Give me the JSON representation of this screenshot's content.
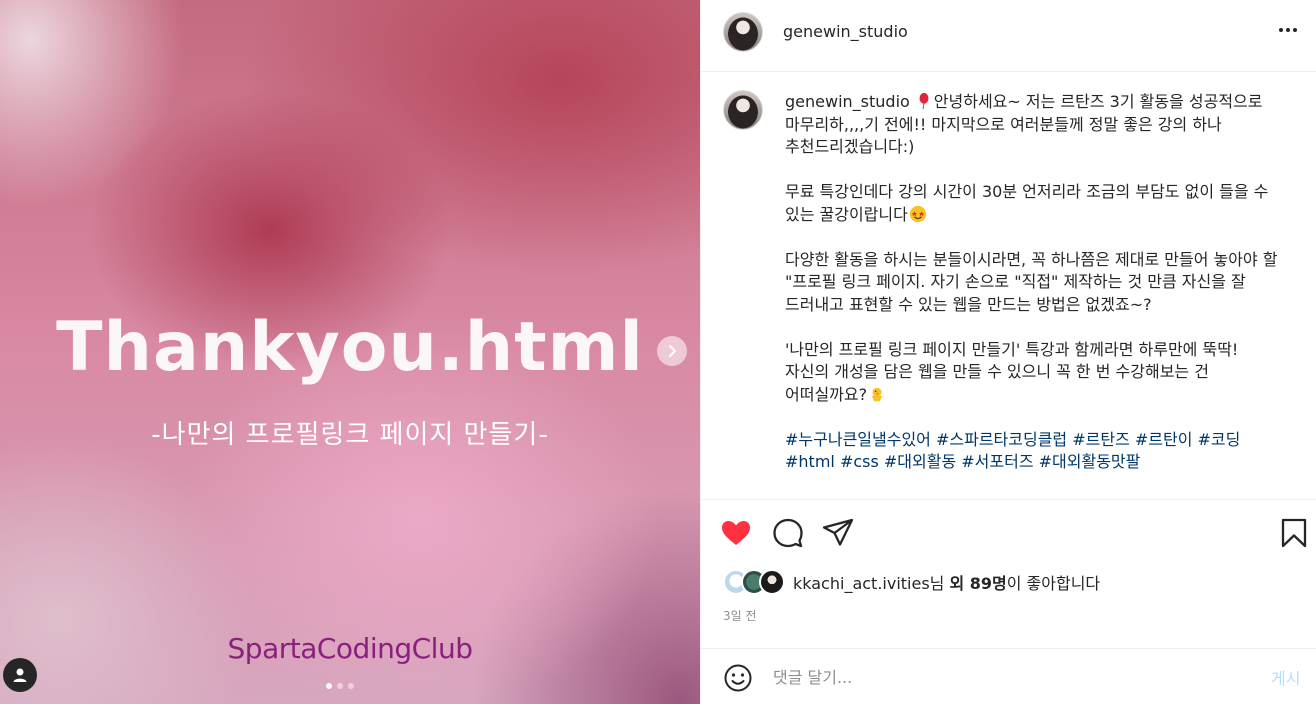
{
  "media": {
    "headline": "Thankyou.html",
    "subline": "-나만의 프로필링크 페이지 만들기-",
    "brand": "SpartaCodingClub",
    "next_icon": "chevron-right-icon",
    "slides": 3,
    "active_slide": 1
  },
  "header": {
    "username": "genewin_studio",
    "more_icon": "more-horizontal-icon"
  },
  "caption": {
    "username": "genewin_studio",
    "p1": "안녕하세요~ 저는 르탄즈 3기 활동을 성공적으로 마무리하,,,,기 전에!! 마지막으로 여러분들께 정말 좋은 강의 하나 추천드리겠습니다:)",
    "p2": "무료 특강인데다 강의 시간이 30분 언저리라 조금의 부담도 없이 들을 수 있는 꿀강이랍니다",
    "p3": "다양한 활동을 하시는 분들이시라면, 꼭 하나쯤은 제대로 만들어 놓아야 할 \"프로필 링크 페이지. 자기 손으로 \"직접\" 제작하는 것 만큼 자신을 잘 드러내고 표현할 수 있는 웹을 만드는 방법은 없겠죠~?",
    "p4": "'나만의 프로필 링크 페이지 만들기' 특강과 함께라면 하루만에 뚝딱! 자신의 개성을 담은 웹을 만들 수 있으니 꼭 한 번 수강해보는 건 어떠실까요?",
    "hashtags": "#누구나큰일낼수있어 #스파르타코딩클럽 #르탄즈 #르탄이 #코딩 #html #css #대외활동 #서포터즈 #대외활동맛팔"
  },
  "actions": {
    "like_icon": "heart-filled-icon",
    "comment_icon": "comment-icon",
    "share_icon": "send-icon",
    "save_icon": "bookmark-icon",
    "like_color": "#ff3040"
  },
  "likes": {
    "liker": "kkachi_act.ivities",
    "suffix1": "님 ",
    "others": "외 89명",
    "suffix2": "이 좋아합니다"
  },
  "timestamp": "3일 전",
  "comment": {
    "placeholder": "댓글 달기...",
    "post_label": "게시",
    "emoji_icon": "smile-icon"
  }
}
